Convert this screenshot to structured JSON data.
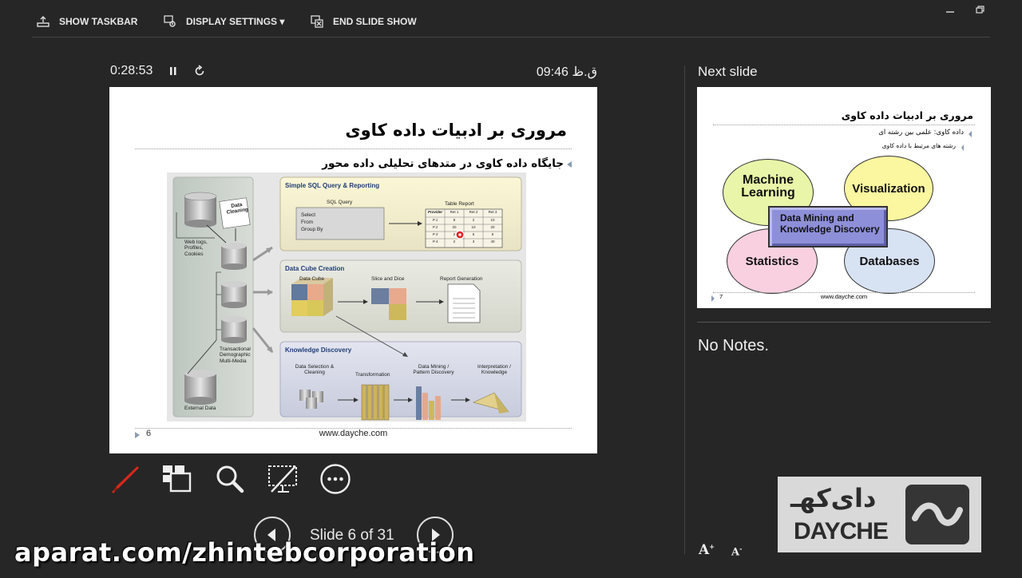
{
  "toolbar": {
    "show_taskbar": "SHOW TASKBAR",
    "display_settings": "DISPLAY SETTINGS",
    "end_slide_show": "END SLIDE SHOW"
  },
  "presenter": {
    "elapsed": "0:28:53",
    "clock": "09:46 ق.ظ",
    "slide_count": "Slide 6 of 31",
    "next_label": "Next slide",
    "notes": "No Notes."
  },
  "current_slide": {
    "title": "مروری بر ادبیات داده کاوی",
    "bullet": "جایگاه داده کاوی در متدهای تحلیلی داده محور",
    "number": "6",
    "url": "www.dayche.com",
    "figure": {
      "left_labels": {
        "data_cleaning": "Data Cleaning",
        "web_logs": "Web logs, Profiles, Cookies",
        "transactional": "Transactional Demographic Multi-Media",
        "external": "External Data"
      },
      "sql": {
        "title": "Simple SQL Query & Reporting",
        "query_label": "SQL Query",
        "query_lines": [
          "Select",
          "From",
          "Group By"
        ],
        "report_label": "Table Report",
        "table_header": [
          "Provider",
          "Ret 1",
          "Ret 2",
          "Ret 3"
        ],
        "table_rows": [
          [
            "P 1",
            "8",
            "2",
            "10"
          ],
          [
            "P 2",
            "20",
            "10",
            "20"
          ],
          [
            "P 3",
            "2",
            "5",
            "5"
          ],
          [
            "P 4",
            "2",
            "3",
            "40"
          ]
        ]
      },
      "cube": {
        "title": "Data Cube Creation",
        "data_cube": "Data Cube",
        "slice_dice": "Slice and Dice",
        "report_gen": "Report Generation"
      },
      "kd": {
        "title": "Knowledge Discovery",
        "selection": "Data Selection & Cleaning",
        "transformation": "Transformation",
        "mining": "Data Mining / Pattern Discovery",
        "interpretation": "Interpretation / Knowledge"
      }
    }
  },
  "next_slide": {
    "title": "مروری بر ادبیات داده کاوی",
    "bullet1": "داده کاوی: علمی بین رشته ای",
    "bullet2": "رشته های مرتبط با داده کاوی",
    "ml": "Machine Learning",
    "vis": "Visualization",
    "stats": "Statistics",
    "db": "Databases",
    "center": "Data Mining and Knowledge Discovery",
    "number": "7",
    "url": "www.dayche.com"
  },
  "watermark": "aparat.com/zhintebcorporation",
  "logo": {
    "persian": "دای‌کهـ",
    "latin": "DAYCHE"
  },
  "fonts": {
    "increase": "A",
    "decrease": "A"
  },
  "colors": {
    "background": "#262626",
    "pen_red": "#d9271c",
    "ml_fill": "#e9f5a8",
    "vis_fill": "#fbf7a0",
    "stats_fill": "#f9d0e0",
    "db_fill": "#d7e2f3",
    "center_fill": "#8e8fd9"
  },
  "icons": [
    "taskbar-icon",
    "display-settings-icon",
    "end-show-icon",
    "minimize-icon",
    "restore-icon",
    "pause-icon",
    "restart-icon",
    "pen-icon",
    "see-all-slides-icon",
    "zoom-icon",
    "black-screen-icon",
    "more-options-icon",
    "previous-icon",
    "next-icon"
  ]
}
